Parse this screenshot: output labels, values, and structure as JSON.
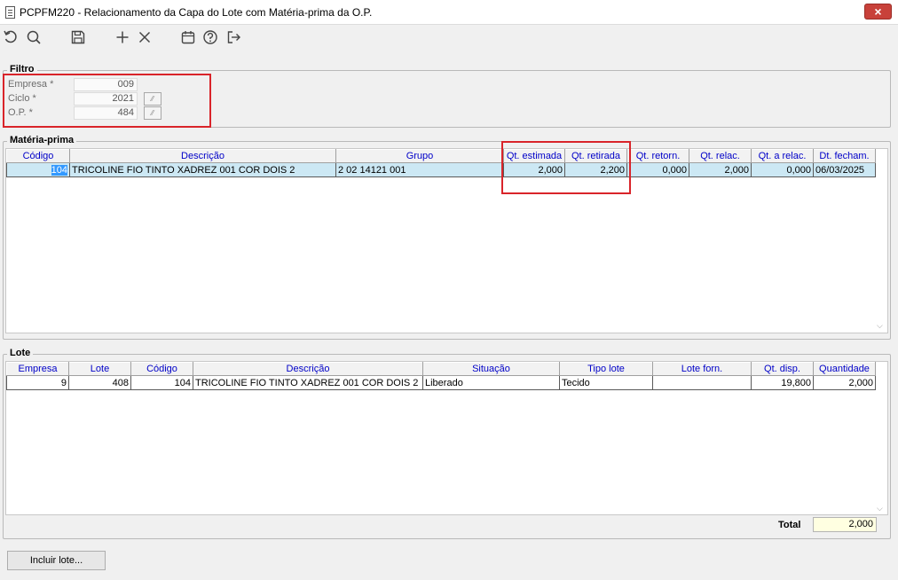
{
  "window": {
    "title": "PCPFM220 - Relacionamento da Capa do Lote com Matéria-prima da O.P.",
    "close_symbol": "×"
  },
  "toolbar": {
    "icons": [
      "refresh-icon",
      "search-icon",
      "save-icon",
      "add-icon",
      "delete-icon",
      "calendar-icon",
      "help-icon",
      "exit-icon"
    ]
  },
  "filtro": {
    "label": "Filtro",
    "fields": [
      {
        "label": "Empresa *",
        "value": "009"
      },
      {
        "label": "Ciclo *",
        "value": "2021"
      },
      {
        "label": "O.P. *",
        "value": "484"
      }
    ]
  },
  "materia_prima": {
    "label": "Matéria-prima",
    "columns": [
      "Código",
      "Descrição",
      "Grupo",
      "Qt. estimada",
      "Qt. retirada",
      "Qt. retorn.",
      "Qt. relac.",
      "Qt. a relac.",
      "Dt. fecham."
    ],
    "rows": [
      [
        "104",
        "TRICOLINE FIO TINTO XADREZ 001 COR DOIS 2",
        "2 02 14121 001",
        "2,000",
        "2,200",
        "0,000",
        "2,000",
        "0,000",
        "06/03/2025"
      ]
    ]
  },
  "lote": {
    "label": "Lote",
    "columns": [
      "Empresa",
      "Lote",
      "Código",
      "Descrição",
      "Situação",
      "Tipo lote",
      "Lote forn.",
      "Qt. disp.",
      "Quantidade"
    ],
    "rows": [
      [
        "9",
        "408",
        "104",
        "TRICOLINE FIO TINTO XADREZ 001 COR DOIS 2",
        "Liberado",
        "Tecido",
        "",
        "19,800",
        "2,000"
      ]
    ],
    "total_label": "Total",
    "total_value": "2,000"
  },
  "actions": {
    "incluir_lote": "Incluir lote..."
  },
  "colors": {
    "header_text": "#0000c8",
    "selected_row": "#cce8f4",
    "highlight_box": "#d9242a",
    "total_bg": "#ffffe1"
  }
}
